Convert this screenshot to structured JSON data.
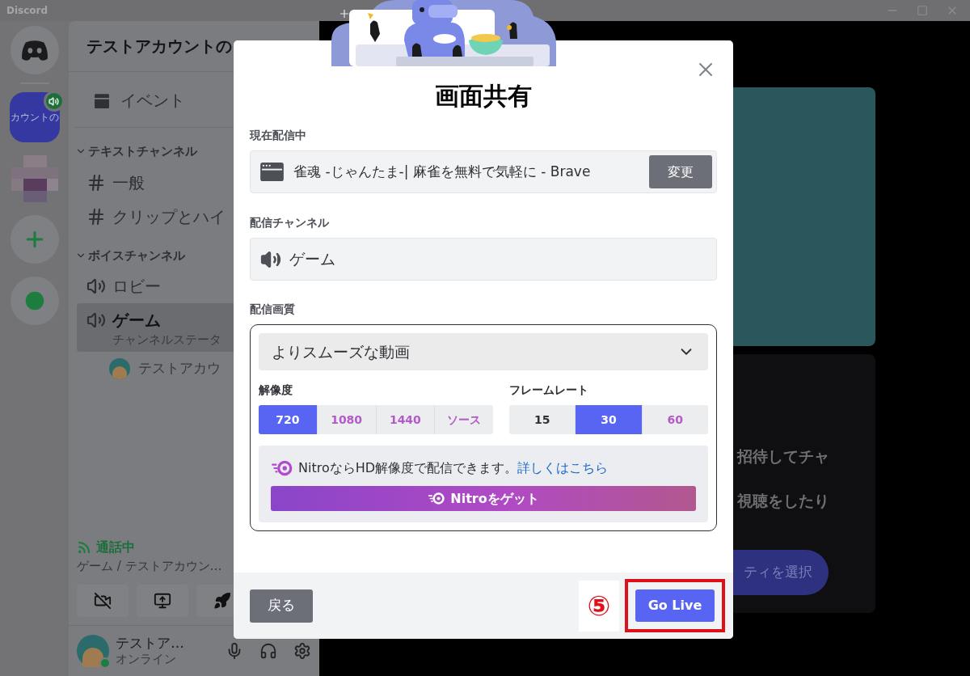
{
  "titlebar": {
    "app_name": "Discord"
  },
  "server_rail": [
    {
      "kind": "home"
    },
    {
      "kind": "server",
      "label": "カウントの",
      "selected": true
    },
    {
      "kind": "blurred"
    },
    {
      "kind": "add"
    },
    {
      "kind": "explore"
    }
  ],
  "sidebar": {
    "server_name": "テストアカウントの",
    "events": "イベント",
    "categories": [
      {
        "name": "テキストチャンネル",
        "expanded": true,
        "channels": [
          {
            "kind": "text",
            "name": "一般",
            "selected": false
          },
          {
            "kind": "text",
            "name": "クリップとハイ",
            "selected": false
          }
        ]
      },
      {
        "name": "ボイスチャンネル",
        "expanded": true,
        "channels": [
          {
            "kind": "voice",
            "name": "ロビー",
            "selected": false
          },
          {
            "kind": "voice",
            "name": "ゲーム",
            "selected": true,
            "status": "チャンネルステータ",
            "members": [
              {
                "name": "テストアカウ"
              }
            ]
          }
        ]
      }
    ]
  },
  "voice_panel": {
    "status": "通話中",
    "detail": "ゲーム / テストアカウン…"
  },
  "user_panel": {
    "name": "テストア…",
    "status": "オンライン"
  },
  "main": {
    "lines": [
      "招待してチャ",
      "視聴をしたり"
    ],
    "button": "ティを選択"
  },
  "modal": {
    "title": "画面共有",
    "source_label": "現在配信中",
    "source": "雀魂 -じゃんたま-| 麻雀を無料で気軽に - Brave",
    "change_button": "変更",
    "channel_label": "配信チャンネル",
    "channel": "ゲーム",
    "quality_label": "配信画質",
    "preset": "よりスムーズな動画",
    "resolution_label": "解像度",
    "resolutions": [
      {
        "label": "720",
        "selected": true,
        "locked": false
      },
      {
        "label": "1080",
        "selected": false,
        "locked": true
      },
      {
        "label": "1440",
        "selected": false,
        "locked": true
      },
      {
        "label": "ソース",
        "selected": false,
        "locked": true
      }
    ],
    "framerate_label": "フレームレート",
    "framerates": [
      {
        "label": "15",
        "selected": false,
        "locked": false
      },
      {
        "label": "30",
        "selected": true,
        "locked": false
      },
      {
        "label": "60",
        "selected": false,
        "locked": true
      }
    ],
    "nitro_text": "NitroならHD解像度で配信できます。",
    "nitro_link": "詳しくはこちら",
    "nitro_button": "Nitroをゲット",
    "back_button": "戻る",
    "go_live_button": "Go Live"
  },
  "annotation": {
    "label": "⑤"
  }
}
